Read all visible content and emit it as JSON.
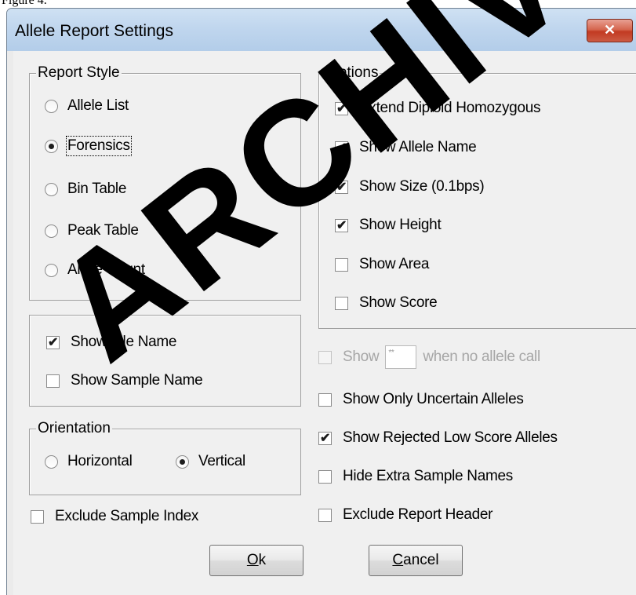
{
  "page_caption": "Figure 4.",
  "dialog": {
    "title": "Allele Report Settings",
    "close_glyph": "✕"
  },
  "report_style": {
    "legend": "Report Style",
    "options": [
      {
        "label": "Allele List",
        "selected": false
      },
      {
        "label": "Forensics",
        "selected": true
      },
      {
        "label": "Bin Table",
        "selected": false
      },
      {
        "label": "Peak Table",
        "selected": false
      },
      {
        "label": "Allele Count",
        "selected": false
      }
    ]
  },
  "options_group": {
    "legend": "Options",
    "items": [
      {
        "label": "Extend Diploid Homozygous",
        "checked": true
      },
      {
        "label": "Show Allele Name",
        "checked": true
      },
      {
        "label": "Show Size (0.1bps)",
        "checked": true
      },
      {
        "label": "Show Height",
        "checked": true
      },
      {
        "label": "Show Area",
        "checked": false
      },
      {
        "label": "Show Score",
        "checked": false
      }
    ]
  },
  "name_group": {
    "items": [
      {
        "label": "Show File Name",
        "checked": true
      },
      {
        "label": "Show Sample Name",
        "checked": false
      }
    ]
  },
  "orientation": {
    "legend": "Orientation",
    "options": [
      {
        "label": "Horizontal",
        "selected": false
      },
      {
        "label": "Vertical",
        "selected": true
      }
    ]
  },
  "exclude_sample_index": {
    "label": "Exclude Sample Index",
    "checked": false
  },
  "no_call_row": {
    "prefix": "Show",
    "field_value": "**",
    "suffix": "when no allele call",
    "checked": false,
    "enabled": false
  },
  "right_checks": [
    {
      "label": "Show Only Uncertain Alleles",
      "checked": false
    },
    {
      "label": "Show Rejected Low Score Alleles",
      "checked": true
    },
    {
      "label": "Hide Extra Sample Names",
      "checked": false
    },
    {
      "label": "Exclude Report Header",
      "checked": false
    }
  ],
  "buttons": {
    "ok_mnemonic": "O",
    "ok_rest": "k",
    "cancel_mnemonic": "C",
    "cancel_rest": "ancel"
  },
  "watermark": "ARCHIVED",
  "colors": {
    "titlebar": "#c0d6ee",
    "close_button": "#c9482f",
    "client_background": "#f0f0f0"
  }
}
